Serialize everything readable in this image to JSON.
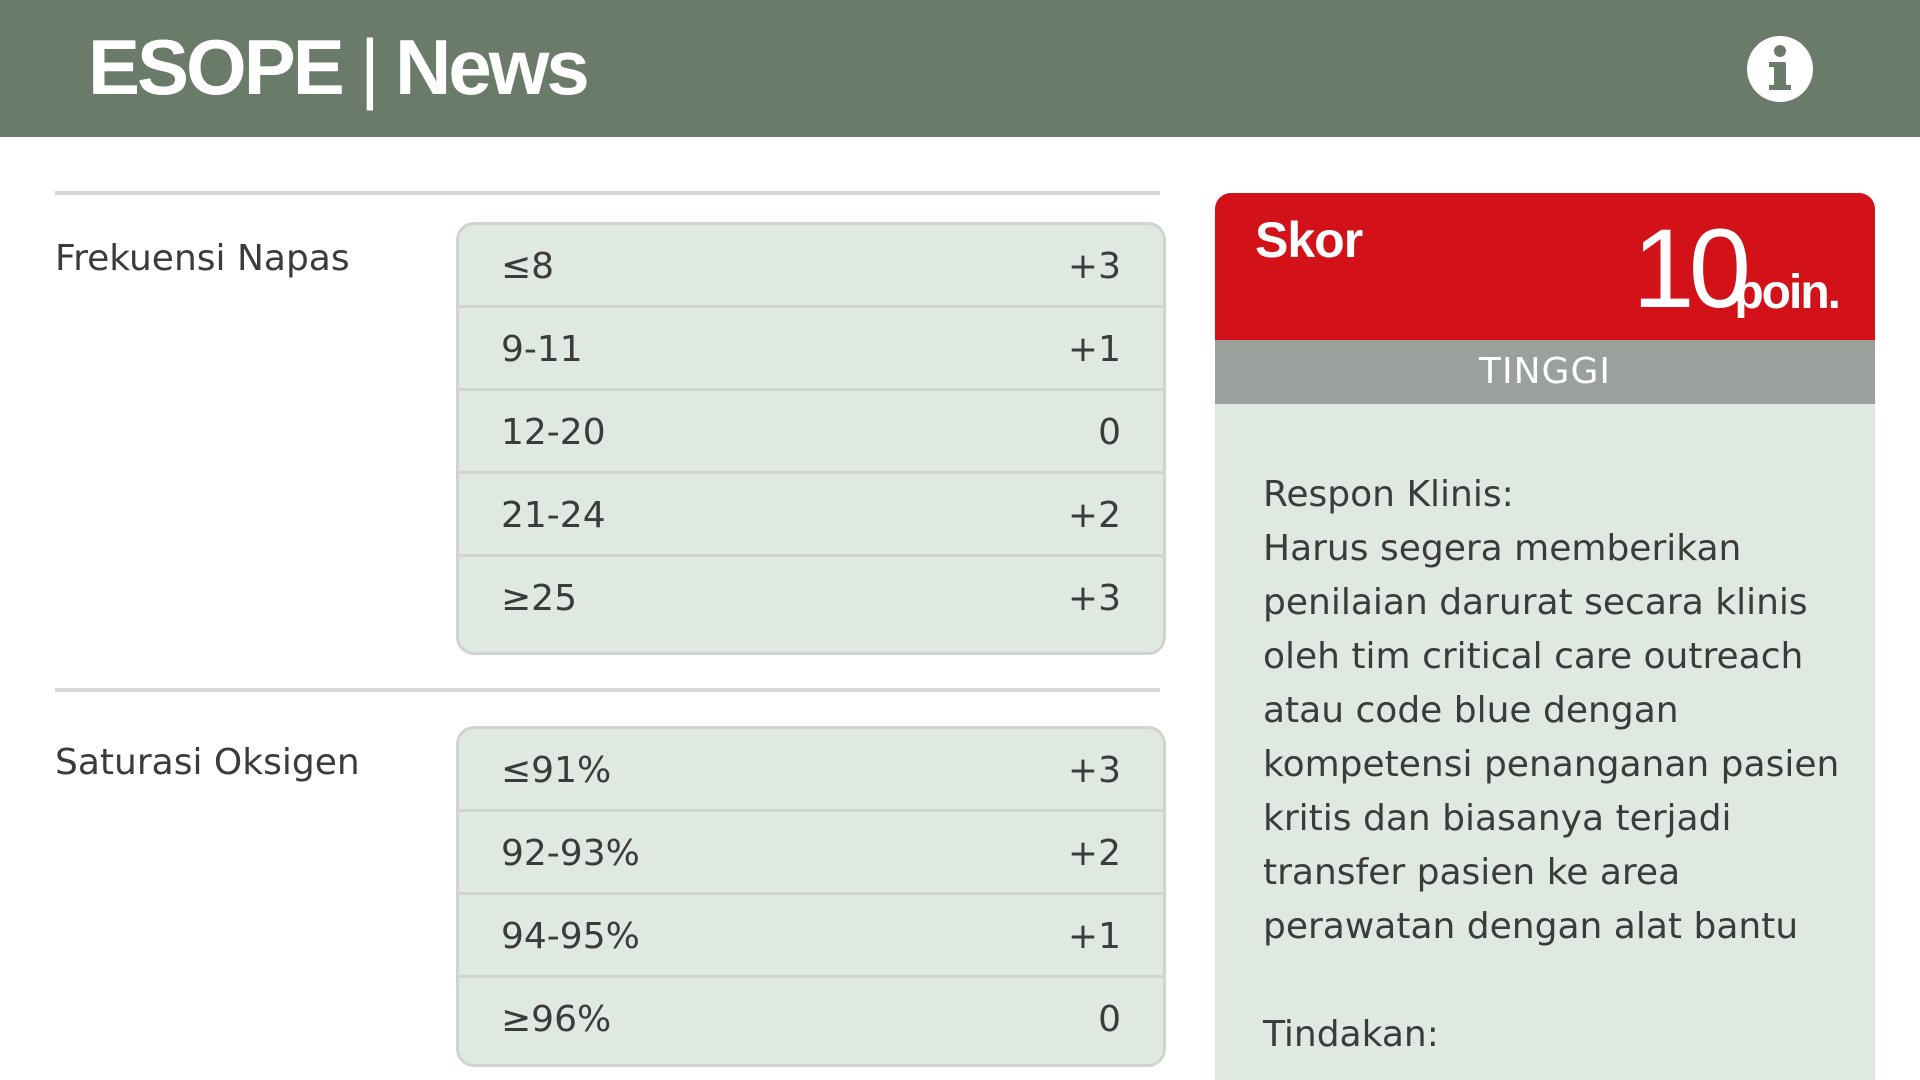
{
  "header": {
    "app_name": "ESOPE",
    "separator": "|",
    "section": "News",
    "info_icon": "info-circle-icon"
  },
  "parameters": [
    {
      "label": "Frekuensi Napas",
      "options": [
        {
          "range": "≤8",
          "points": "+3"
        },
        {
          "range": "9-11",
          "points": "+1"
        },
        {
          "range": "12-20",
          "points": "0"
        },
        {
          "range": "21-24",
          "points": "+2"
        },
        {
          "range": "≥25",
          "points": "+3"
        }
      ]
    },
    {
      "label": "Saturasi Oksigen",
      "options": [
        {
          "range": "≤91%",
          "points": "+3"
        },
        {
          "range": "92-93%",
          "points": "+2"
        },
        {
          "range": "94-95%",
          "points": "+1"
        },
        {
          "range": "≥96%",
          "points": "0"
        }
      ]
    }
  ],
  "score": {
    "label": "Skor",
    "value": "10",
    "unit": "poin.",
    "level": "TINGGI",
    "response_title": "Respon Klinis:",
    "response_text": "Harus segera memberikan penilaian darurat secara klinis oleh tim critical care outreach atau code blue dengan kompetensi penanganan pasien kritis dan biasanya terjadi transfer pasien ke area perawatan dengan alat bantu",
    "action_title": "Tindakan:"
  },
  "colors": {
    "header_bg": "#6b7b6a",
    "score_red": "#d21119",
    "level_gray": "#9aa09c",
    "panel_bg": "#e0e8e2"
  }
}
